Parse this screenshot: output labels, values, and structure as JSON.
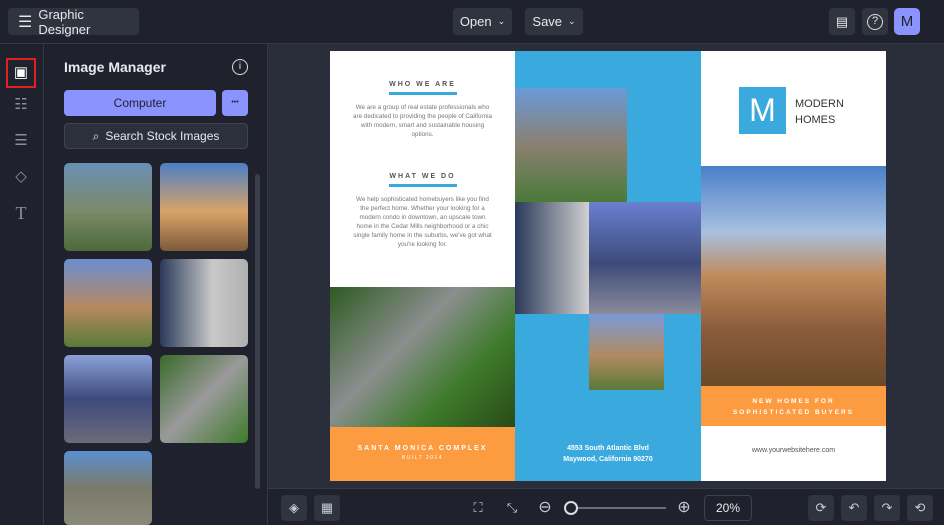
{
  "topbar": {
    "app_title": "Graphic Designer",
    "open_label": "Open",
    "save_label": "Save",
    "avatar_initial": "M"
  },
  "panel": {
    "title": "Image Manager",
    "computer_button": "Computer",
    "more_button": "•••",
    "search_stock": "Search Stock Images"
  },
  "doc": {
    "who_heading": "WHO WE ARE",
    "who_text": "We are a group of real estate professionals who are dedicated to providing the people of California with modern, smart and sustainable housing options.",
    "what_heading": "WHAT WE DO",
    "what_text": "We help sophisticated homebuyers like you find the perfect home. Whether your looking for a modern condo in downtown, an upscale town home in the Cedar Mills neighborhood or a chic single family home in the suburbs, we've got what you're looking for.",
    "complex_name": "SANTA MONICA COMPLEX",
    "complex_built": "BUILT 2014",
    "address_line1": "4553 South Atlantic Blvd",
    "address_line2": "Maywood, California 90270",
    "logo_letter": "M",
    "logo_line1": "MODERN",
    "logo_line2": "HOMES",
    "tagline_line1": "NEW HOMES FOR",
    "tagline_line2": "SOPHISTICATED BUYERS",
    "website": "www.yourwebsitehere.com"
  },
  "bottombar": {
    "zoom_level": "20%",
    "zoom_slider_fraction": 0.0
  },
  "colors": {
    "accent": "#8b93ff",
    "blue": "#3aa9de",
    "orange": "#fc9b3f",
    "highlight": "#e02020"
  }
}
